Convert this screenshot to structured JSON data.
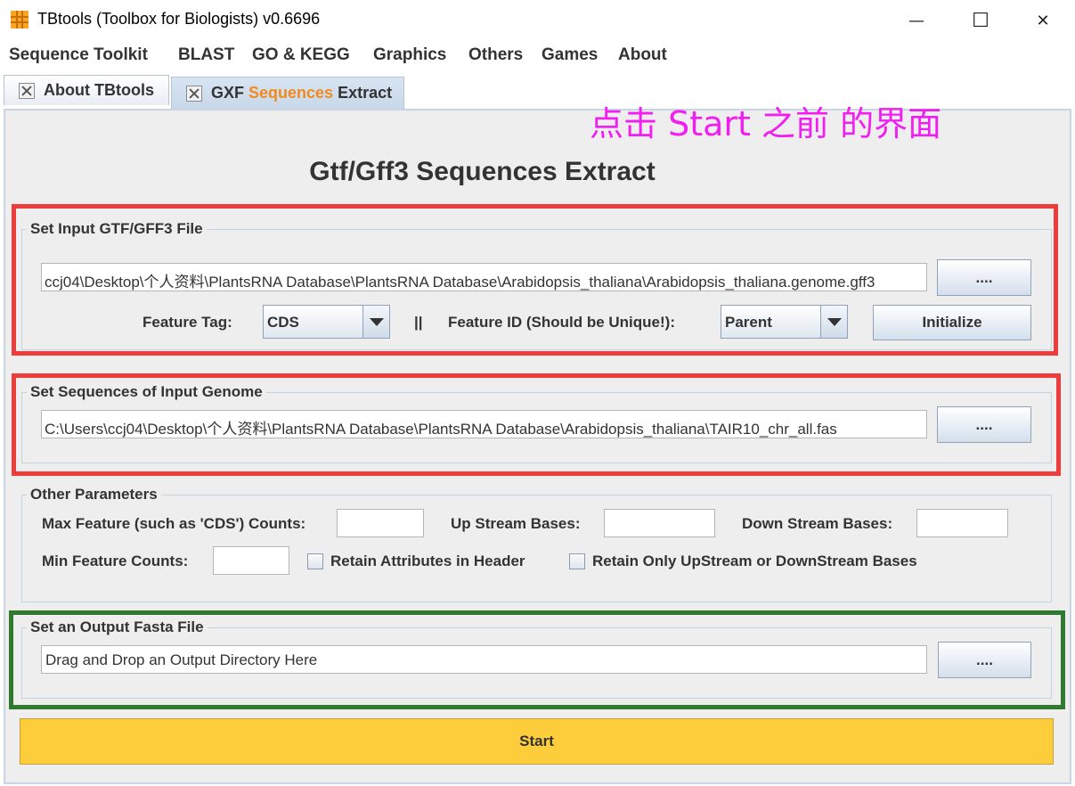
{
  "window": {
    "title": "TBtools (Toolbox for Biologists) v0.6696",
    "minimize_glyph": "—",
    "maximize_glyph": "☐",
    "close_glyph": "✕"
  },
  "menu": {
    "items": [
      "Sequence Toolkit",
      "BLAST",
      "GO & KEGG",
      "Graphics",
      "Others",
      "Games",
      "About"
    ]
  },
  "tabs": [
    {
      "label": "About TBtools"
    },
    {
      "label_prefix": "GXF ",
      "label_highlight": "Sequences",
      "label_suffix": " Extract"
    }
  ],
  "annotation": "点击 Start 之前 的界面",
  "page_title": "Gtf/Gff3 Sequences Extract",
  "input_gff": {
    "group_title": "Set Input GTF/GFF3 File",
    "path": "ccj04\\Desktop\\个人资料\\PlantsRNA Database\\PlantsRNA Database\\Arabidopsis_thaliana\\Arabidopsis_thaliana.genome.gff3",
    "browse_label": "....",
    "feature_tag_label": "Feature Tag:",
    "feature_tag_value": "CDS",
    "separator": "||",
    "feature_id_label": "Feature ID (Should be Unique!):",
    "feature_id_value": "Parent",
    "initialize_label": "Initialize"
  },
  "input_genome": {
    "group_title": "Set Sequences of Input Genome",
    "path": "C:\\Users\\ccj04\\Desktop\\个人资料\\PlantsRNA Database\\PlantsRNA Database\\Arabidopsis_thaliana\\TAIR10_chr_all.fas",
    "browse_label": "...."
  },
  "other_params": {
    "group_title": "Other Parameters",
    "max_feature_label": "Max Feature (such as 'CDS') Counts:",
    "max_feature_value": "",
    "upstream_label": "Up Stream Bases:",
    "upstream_value": "",
    "downstream_label": "Down Stream Bases:",
    "downstream_value": "",
    "min_feature_label": "Min Feature Counts:",
    "min_feature_value": "",
    "retain_attr_label": "Retain Attributes in Header",
    "retain_only_label": "Retain Only UpStream or DownStream Bases"
  },
  "output": {
    "group_title": "Set an Output Fasta File",
    "placeholder": "Drag and Drop an Output Directory Here",
    "browse_label": "...."
  },
  "start_label": "Start",
  "colors": {
    "annotation": "#f21df2",
    "highlight_red": "#ee3b3b",
    "highlight_green": "#2f7a2f",
    "start_button": "#fecd3c",
    "tab_highlight": "#f08a1e"
  }
}
